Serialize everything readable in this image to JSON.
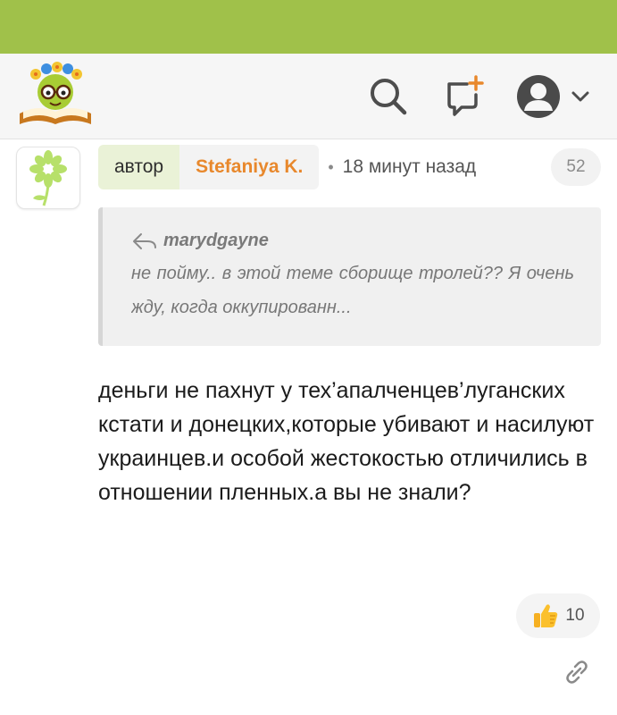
{
  "header": {
    "logo": "sunflower-book-logo",
    "search_icon": "search-icon",
    "new_post_icon": "new-post-icon",
    "profile_icon": "user-icon",
    "dropdown_icon": "chevron-down-icon"
  },
  "post": {
    "author_label": "автор",
    "author_name": "Stefaniya K.",
    "separator": "•",
    "time": "18 минут назад",
    "comment_number": "52",
    "quote": {
      "author": "marydgayne",
      "text": "не пойму.. в этой теме сборище тролей?? Я очень жду, когда оккупированн..."
    },
    "body": "деньги не пахнут у тех’апалченцев’луганских кстати и донецких,которые убивают и насилуют украинцев.и особой жестокостью отличились в отношении пленных.а вы не знали?",
    "likes": "10"
  },
  "colors": {
    "topbar": "#a0c14a",
    "author_label_bg": "#eaf2d7",
    "author_name": "#e8882c"
  }
}
